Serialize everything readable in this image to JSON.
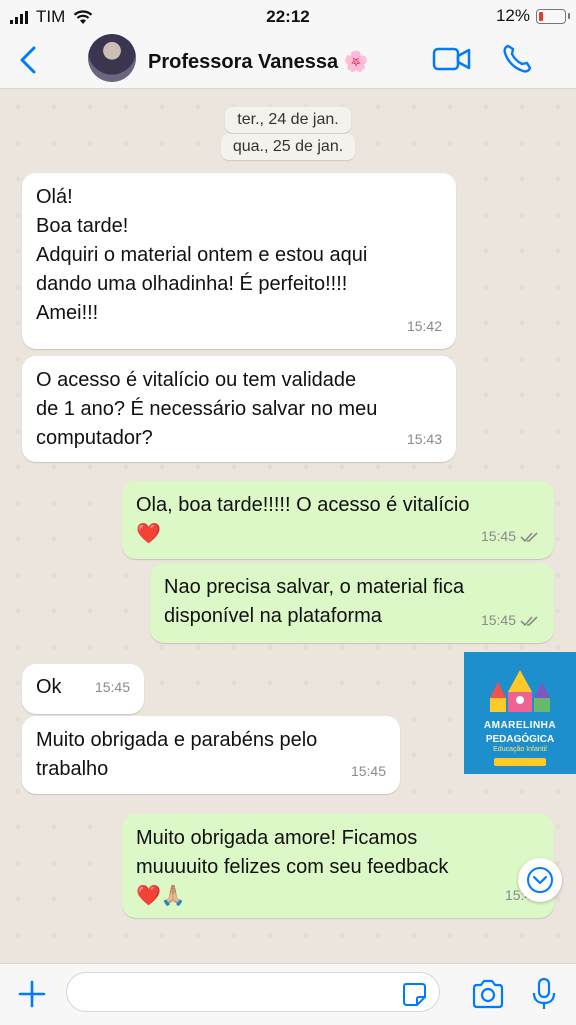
{
  "status_bar": {
    "carrier": "TIM",
    "time": "22:12",
    "battery": "12%",
    "battery_level": 0.12
  },
  "header": {
    "contact_name": "Professora Vanessa 🌸"
  },
  "dates": [
    "ter., 24 de jan.",
    "qua., 25 de jan."
  ],
  "messages": [
    {
      "dir": "in",
      "text": "Olá!\nBoa tarde!\nAdquiri o material ontem e estou aqui\ndando uma olhadinha! É perfeito!!!!\nAmei!!!",
      "time": "15:42"
    },
    {
      "dir": "in",
      "text": "O acesso é vitalício ou tem validade\nde 1 ano? É necessário salvar no meu\ncomputador?",
      "time": "15:43"
    },
    {
      "dir": "out",
      "text": "Ola, boa tarde!!!!! O acesso é vitalício\n❤️",
      "time": "15:45"
    },
    {
      "dir": "out",
      "text": "Nao precisa salvar, o material fica\ndisponível na plataforma",
      "time": "15:45"
    },
    {
      "dir": "in",
      "text": "Ok",
      "time": "15:45"
    },
    {
      "dir": "in",
      "text": "Muito obrigada e parabéns pelo\ntrabalho",
      "time": "15:45"
    },
    {
      "dir": "out",
      "text": "Muito obrigada amore! Ficamos\nmuuuuito felizes com seu feedback\n❤️🙏🏼",
      "time": "15:45"
    }
  ],
  "image_overlay": {
    "line1": "AMARELINHA",
    "line2": "PEDAGÓGICA",
    "line3": "Educação Infantil"
  },
  "composer": {
    "placeholder": ""
  },
  "colors": {
    "accent": "#007aff",
    "incoming_bubble": "#ffffff",
    "outgoing_bubble": "#dcf8c6",
    "chat_background": "#ece5dd"
  }
}
